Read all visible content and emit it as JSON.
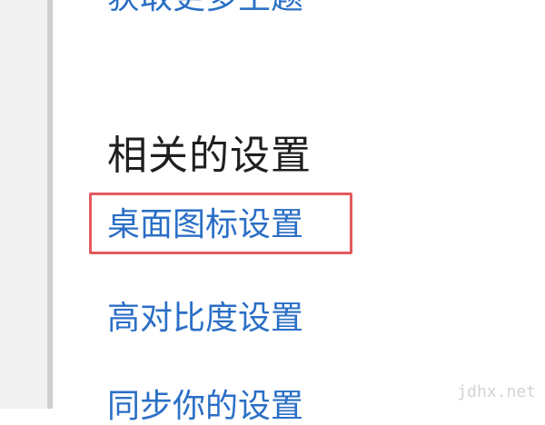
{
  "top_link_partial": "获取更多主题",
  "related_settings": {
    "heading": "相关的设置",
    "items": [
      {
        "label": "桌面图标设置"
      },
      {
        "label": "高对比度设置"
      },
      {
        "label": "同步你的设置"
      }
    ]
  },
  "watermark": "jdhx.net",
  "colors": {
    "link": "#2b6fc6",
    "heading": "#1f1f1f",
    "highlight_border": "#e45a5e",
    "left_edge": "#cfcfcf"
  }
}
